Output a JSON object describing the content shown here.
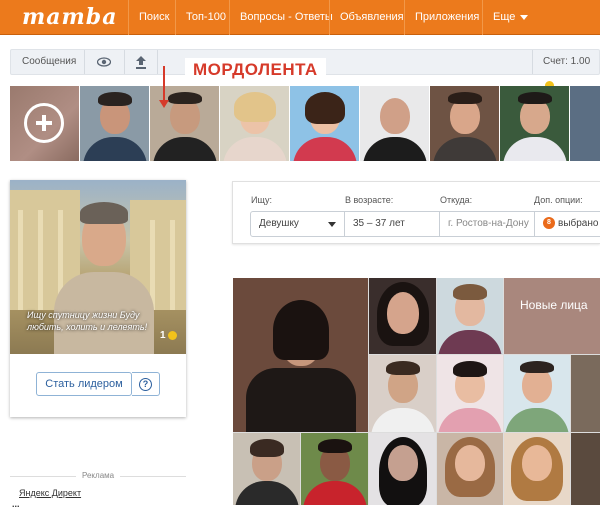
{
  "nav": {
    "logo": "mamba",
    "items": [
      "Поиск",
      "Топ-100",
      "Вопросы - Ответы",
      "Объявления",
      "Приложения",
      "Еще"
    ]
  },
  "toolbar": {
    "messages_label": "Сообщения",
    "balance_label": "Счет: 1.00"
  },
  "annotation": {
    "label": "МОРДОЛЕНТА"
  },
  "leader_card": {
    "quote": "Ищу спутницу жизни Буду любить, холить и лелеять!",
    "coin_count": "1",
    "become_leader_label": "Стать лидером",
    "help_label": "?"
  },
  "ads": {
    "label": "Реклама",
    "link": "Яндекс Директ",
    "more": "..."
  },
  "search": {
    "looking_for_label": "Ищу:",
    "looking_for_value": "Девушку",
    "age_label": "В возрасте:",
    "age_value": "35 – 37 лет",
    "from_label": "Откуда:",
    "from_value": "г. Ростов-на-Дону",
    "options_label": "Доп. опции:",
    "options_badge": "8",
    "options_value": "выбрано"
  },
  "grid": {
    "new_faces_label": "Новые лица"
  },
  "colors": {
    "brand_orange": "#ec7a1c",
    "annotation_red": "#d63a2a",
    "link_blue": "#2b5f9e"
  }
}
